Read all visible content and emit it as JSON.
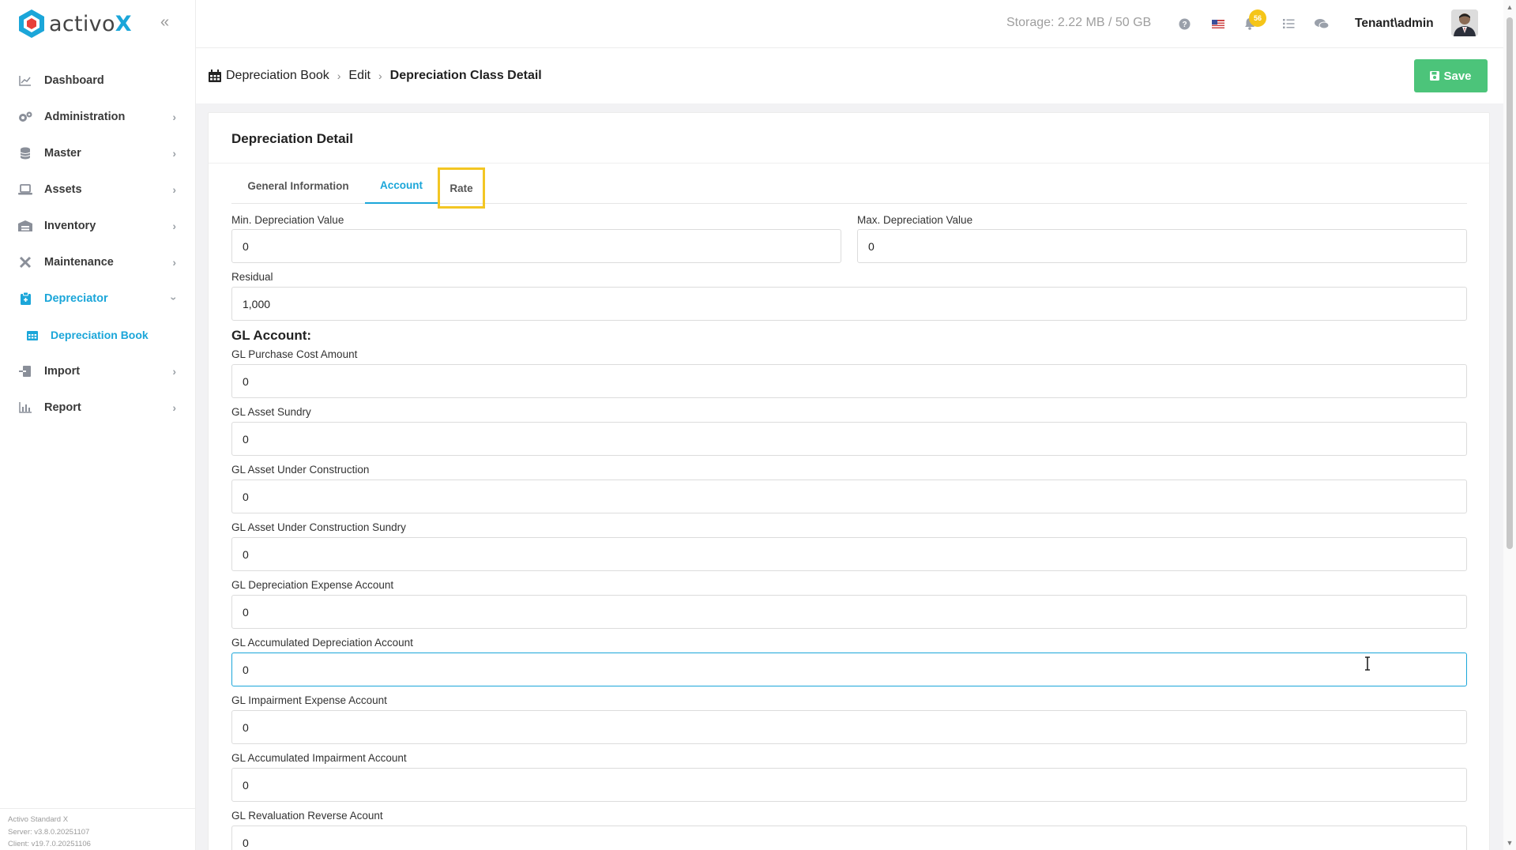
{
  "app": {
    "logo_text_main": "activo",
    "logo_text_accent": "X",
    "brand_color": "#1ba6d9",
    "accent_yellow": "#f3c623",
    "save_green": "#4cc47a"
  },
  "sidebar": {
    "items": [
      {
        "label": "Dashboard",
        "icon": "chart-line-icon",
        "has_chevron": false
      },
      {
        "label": "Administration",
        "icon": "cogs-icon",
        "has_chevron": true
      },
      {
        "label": "Master",
        "icon": "database-icon",
        "has_chevron": true
      },
      {
        "label": "Assets",
        "icon": "laptop-icon",
        "has_chevron": true
      },
      {
        "label": "Inventory",
        "icon": "warehouse-icon",
        "has_chevron": true
      },
      {
        "label": "Maintenance",
        "icon": "tools-icon",
        "has_chevron": true
      },
      {
        "label": "Depreciator",
        "icon": "clipboard-icon",
        "has_chevron": true,
        "expanded": true
      },
      {
        "label": "Import",
        "icon": "file-import-icon",
        "has_chevron": true
      },
      {
        "label": "Report",
        "icon": "bar-chart-icon",
        "has_chevron": true
      }
    ],
    "sub_item": {
      "label": "Depreciation Book",
      "icon": "calendar-icon"
    },
    "footer": {
      "product": "Activo Standard X",
      "server": "Server: v3.8.0.20251107",
      "client": "Client: v19.7.0.20251106"
    }
  },
  "topbar": {
    "storage": "Storage: 2.22 MB / 50 GB",
    "notification_count": "56",
    "user": "Tenant\\admin"
  },
  "breadcrumb": {
    "root": "Depreciation Book",
    "middle": "Edit",
    "current": "Depreciation Class Detail"
  },
  "actions": {
    "save_label": "Save"
  },
  "card": {
    "title": "Depreciation Detail",
    "tabs": [
      {
        "label": "General Information",
        "active": false
      },
      {
        "label": "Account",
        "active": true
      },
      {
        "label": "Rate",
        "active": false,
        "highlighted": true
      }
    ]
  },
  "form": {
    "min_depreciation": {
      "label": "Min. Depreciation Value",
      "value": "0"
    },
    "max_depreciation": {
      "label": "Max. Depreciation Value",
      "value": "0"
    },
    "residual": {
      "label": "Residual",
      "value": "1,000"
    },
    "gl_section_title": "GL Account:",
    "gl_fields": [
      {
        "label": "GL Purchase Cost Amount",
        "value": "0"
      },
      {
        "label": "GL Asset Sundry",
        "value": "0"
      },
      {
        "label": "GL Asset Under Construction",
        "value": "0"
      },
      {
        "label": "GL Asset Under Construction Sundry",
        "value": "0"
      },
      {
        "label": "GL Depreciation Expense Account",
        "value": "0"
      },
      {
        "label": "GL Accumulated Depreciation Account",
        "value": "0",
        "focused": true
      },
      {
        "label": "GL Impairment Expense Account",
        "value": "0"
      },
      {
        "label": "GL Accumulated Impairment Account",
        "value": "0"
      },
      {
        "label": "GL Revaluation Reverse Acount",
        "value": "0"
      }
    ]
  }
}
